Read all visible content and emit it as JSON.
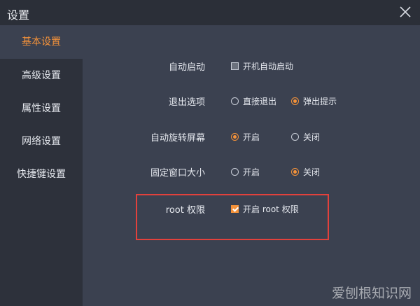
{
  "window": {
    "title": "设置"
  },
  "sidebar": {
    "items": [
      {
        "label": "基本设置",
        "active": true
      },
      {
        "label": "高级设置"
      },
      {
        "label": "属性设置"
      },
      {
        "label": "网络设置"
      },
      {
        "label": "快捷键设置"
      }
    ]
  },
  "settings": {
    "autostart": {
      "label": "自动启动",
      "option": "开机自动启动",
      "checked": false
    },
    "exit": {
      "label": "退出选项",
      "options": [
        "直接退出",
        "弹出提示"
      ],
      "selected": "弹出提示"
    },
    "rotate": {
      "label": "自动旋转屏幕",
      "options": [
        "开启",
        "关闭"
      ],
      "selected": "开启"
    },
    "fixed_size": {
      "label": "固定窗口大小",
      "options": [
        "开启",
        "关闭"
      ],
      "selected": "关闭"
    },
    "root": {
      "label": "root 权限",
      "option": "开启 root 权限",
      "checked": true
    }
  },
  "watermark": "爱刨根知识网",
  "colors": {
    "accent": "#f4923a",
    "highlight": "#e2413c",
    "background": "#3b4150",
    "sidebar": "#2d313b"
  },
  "icons": {
    "close": "close-icon"
  }
}
